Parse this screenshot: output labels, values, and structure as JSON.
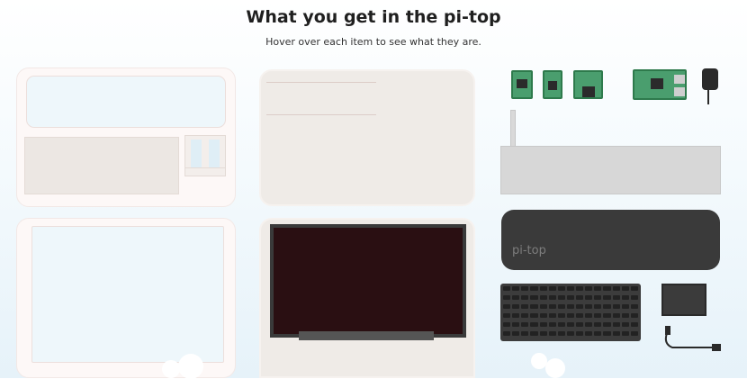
{
  "header": {
    "title": "What you get in the pi-top",
    "subtitle": "Hover over each item to see what they are."
  },
  "case_label": "pi-top",
  "colors": {
    "title": "#1f1f1f",
    "shell": "#fdf8f7",
    "panel_beige": "#efebe7",
    "screen": "#2a0f12",
    "board_green": "#4a9e6e",
    "case_dark": "#3a3a3a",
    "hub_gray": "#d7d7d7"
  },
  "items": [
    {
      "name": "keyboard-base-shell-icon"
    },
    {
      "name": "screen-back-cover-icon"
    },
    {
      "name": "screen-bezel-frame-icon"
    },
    {
      "name": "lcd-screen-icon"
    },
    {
      "name": "add-on-board-icon"
    },
    {
      "name": "speaker-board-icon"
    },
    {
      "name": "proto-board-icon"
    },
    {
      "name": "raspberry-pi-icon"
    },
    {
      "name": "power-adapter-icon"
    },
    {
      "name": "hub-rail-icon"
    },
    {
      "name": "battery-case-icon"
    },
    {
      "name": "keyboard-icon"
    },
    {
      "name": "trackpad-icon"
    },
    {
      "name": "usb-cable-icon"
    }
  ]
}
